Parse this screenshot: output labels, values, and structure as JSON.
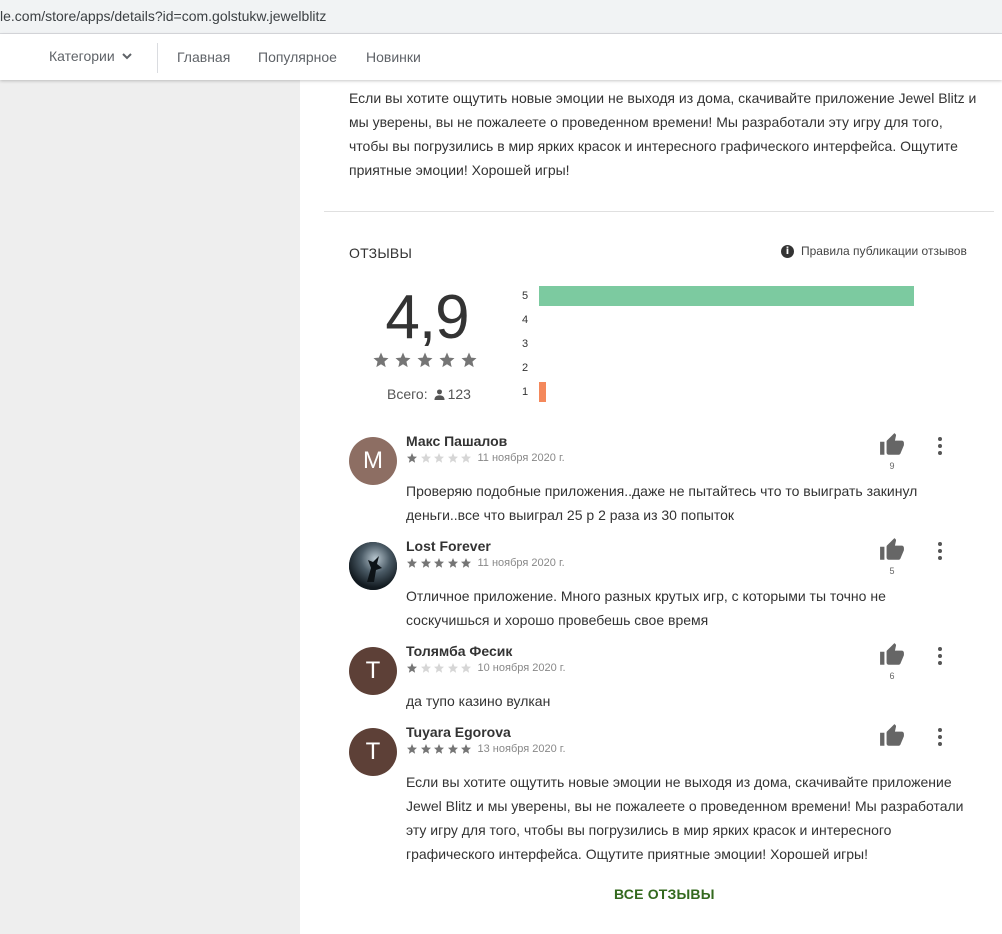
{
  "browser": {
    "url": "le.com/store/apps/details?id=com.golstukw.jewelblitz"
  },
  "nav": {
    "categories": "Категории",
    "links": [
      "Главная",
      "Популярное",
      "Новинки"
    ]
  },
  "description": "Если вы хотите ощутить новые эмоции не выходя из дома, скачивайте приложение Jewel Blitz и мы уверены, вы не пожалеете о проведенном времени! Мы разработали эту игру для того, чтобы вы погрузились в мир ярких красок и интересного графического интерфейса. Ощутите приятные эмоции! Хорошей игры!",
  "reviews_section": {
    "title": "ОТЗЫВЫ",
    "rules_link": "Правила публикации отзывов",
    "rules_icon": "info-icon",
    "rating": "4,9",
    "rating_stars": 5,
    "total_label": "Всего:",
    "total_count": "123",
    "histogram": [
      {
        "label": "5",
        "fraction": 1.0,
        "color": "#7ccaa0"
      },
      {
        "label": "4",
        "fraction": 0,
        "color": "#b4d96b"
      },
      {
        "label": "3",
        "fraction": 0,
        "color": "#ffd54f"
      },
      {
        "label": "2",
        "fraction": 0,
        "color": "#ffb74d"
      },
      {
        "label": "1",
        "fraction": 0.019,
        "color": "#f4885b"
      }
    ],
    "all_reviews": "ВСЕ ОТЗЫВЫ"
  },
  "reviews": [
    {
      "name": "Макс Пашалов",
      "avatar_letter": "M",
      "avatar_color": "#8d6e63",
      "stars": 1,
      "date": "11 ноября 2020 г.",
      "text": "Проверяю подобные приложения..даже не пытайтесь что то выиграть закинул деньги..все что выиграл 25 р 2 раза из 30 попыток",
      "likes": "9"
    },
    {
      "name": "Lost Forever",
      "avatar_letter": "",
      "avatar_color": "#24303a",
      "stars": 5,
      "date": "11 ноября 2020 г.",
      "text": "Отличное приложение. Много разных крутых игр, с которыми ты точно не соскучишься и хорошо провебешь свое время",
      "likes": "5"
    },
    {
      "name": "Толямба Фесик",
      "avatar_letter": "T",
      "avatar_color": "#5d4037",
      "stars": 1,
      "date": "10 ноября 2020 г.",
      "text": "да тупо казино вулкан",
      "likes": "6"
    },
    {
      "name": "Tuyara Egorova",
      "avatar_letter": "T",
      "avatar_color": "#5d4037",
      "stars": 5,
      "date": "13 ноября 2020 г.",
      "text": "Если вы хотите ощутить новые эмоции не выходя из дома, скачивайте приложение Jewel Blitz и мы уверены, вы не пожалеете о проведенном времени! Мы разработали эту игру для того, чтобы вы погрузились в мир ярких красок и интересного графического интерфейса. Ощутите приятные эмоции! Хорошей игры!",
      "likes": ""
    }
  ]
}
